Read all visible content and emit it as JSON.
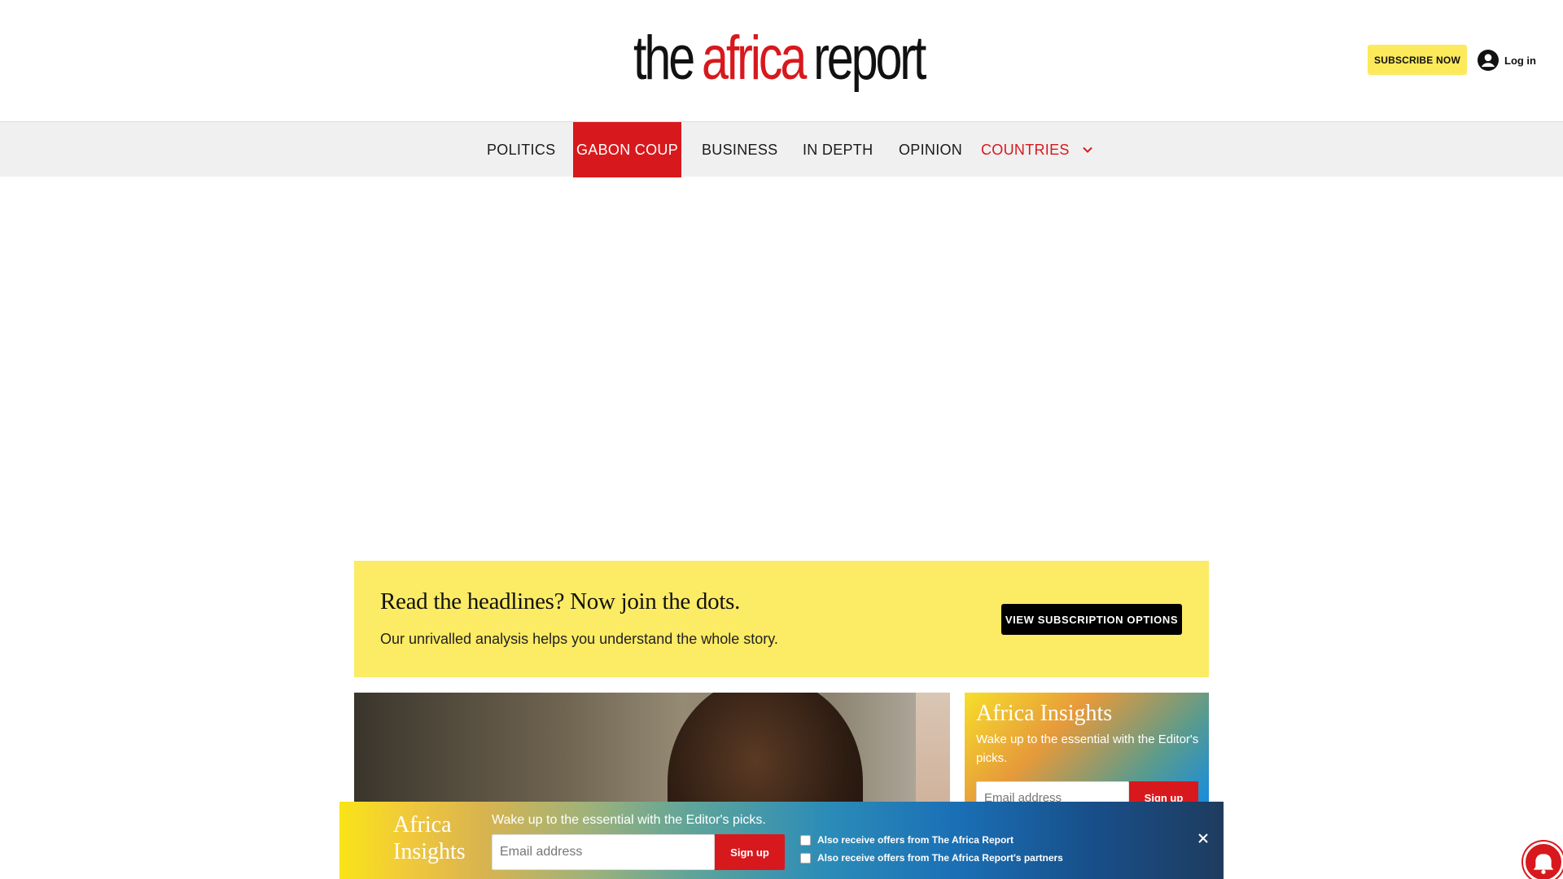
{
  "header": {
    "logo": {
      "word1": "the",
      "word2": "africa",
      "word3": "report"
    },
    "subscribe_label": "SUBSCRIBE NOW",
    "login_label": "Log in"
  },
  "nav": {
    "items": [
      {
        "label": "POLITICS",
        "state": "normal"
      },
      {
        "label": "GABON COUP",
        "state": "active"
      },
      {
        "label": "BUSINESS",
        "state": "normal"
      },
      {
        "label": "IN DEPTH",
        "state": "normal"
      },
      {
        "label": "OPINION",
        "state": "normal"
      },
      {
        "label": "COUNTRIES",
        "state": "dropdown"
      }
    ]
  },
  "promo": {
    "title": "Read the headlines? Now join the dots.",
    "subtitle": "Our unrivalled analysis helps you understand the whole story.",
    "button_label": "VIEW SUBSCRIPTION OPTIONS"
  },
  "sidebar_newsletter": {
    "title": "Africa Insights",
    "description": "Wake up to the essential with the Editor's picks.",
    "email_placeholder": "Email address",
    "button_label": "Sign up"
  },
  "sticky_newsletter": {
    "title": "Africa Insights",
    "description": "Wake up to the essential with the Editor's picks.",
    "email_placeholder": "Email address",
    "button_label": "Sign up",
    "options": [
      "Also receive offers from The Africa Report",
      "Also receive offers from The Africa Report's partners"
    ]
  },
  "colors": {
    "brand_red": "#d7191d",
    "subscribe_yellow": "#fcea5b",
    "nav_background": "#f0f0f0"
  },
  "icons": {
    "login": "user-circle-icon",
    "countries_dropdown": "chevron-down-icon",
    "close": "close-icon",
    "notifications": "bell-icon"
  }
}
